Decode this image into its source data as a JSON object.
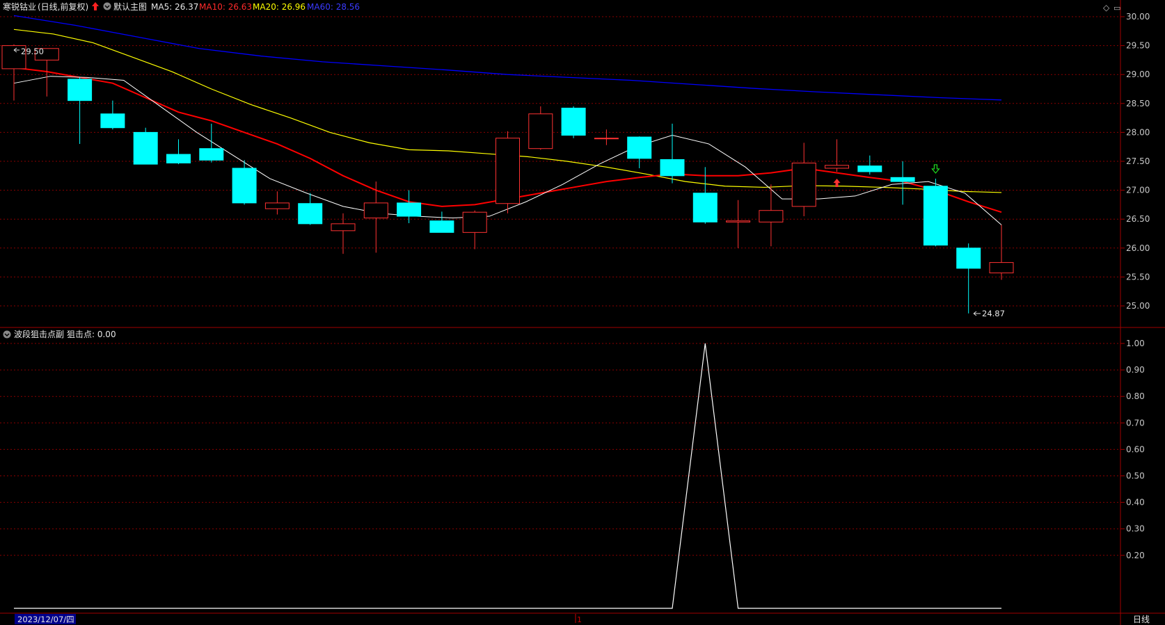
{
  "main_header": {
    "stock_name": "寒锐钴业",
    "period": "(日线,前复权)",
    "template": "默认主图",
    "ma5": "MA5: 26.37",
    "ma10": "MA10: 26.63",
    "ma20": "MA20: 26.96",
    "ma60": "MA60: 28.56"
  },
  "window_controls": {
    "diamond": "◇",
    "menu": "▭"
  },
  "price_axis": [
    "30.00",
    "29.50",
    "29.00",
    "28.50",
    "28.00",
    "27.50",
    "27.00",
    "26.50",
    "26.00",
    "25.50",
    "25.00"
  ],
  "high_label": "29.50",
  "low_label": "24.87",
  "sub_header": {
    "name": "波段狙击点副",
    "value": "狙击点: 0.00"
  },
  "sub_axis": [
    "1.00",
    "0.90",
    "0.80",
    "0.70",
    "0.60",
    "0.50",
    "0.40",
    "0.30",
    "0.20"
  ],
  "date_label": "2023/12/07/四",
  "date_marker": "1",
  "period_button": "日线",
  "colors": {
    "up": "#ff3232",
    "down": "#00ffff",
    "ma5": "#ffffff",
    "ma10": "#ff0000",
    "ma20": "#ffff00",
    "ma60": "#0000ff",
    "grid": "#8b0000",
    "axis_text": "#c8c8c8",
    "border": "#a00000"
  },
  "chart_data": {
    "type": "candlestick",
    "price_range": [
      24.6,
      30.1
    ],
    "sub_range": [
      0,
      1.0
    ],
    "candles": [
      {
        "o": 29.1,
        "h": 29.52,
        "l": 28.55,
        "c": 29.5
      },
      {
        "o": 29.25,
        "h": 29.45,
        "l": 28.62,
        "c": 29.45
      },
      {
        "o": 28.92,
        "h": 28.95,
        "l": 27.8,
        "c": 28.55
      },
      {
        "o": 28.32,
        "h": 28.55,
        "l": 28.05,
        "c": 28.08
      },
      {
        "o": 28.0,
        "h": 28.08,
        "l": 27.45,
        "c": 27.45
      },
      {
        "o": 27.62,
        "h": 27.88,
        "l": 27.45,
        "c": 27.47
      },
      {
        "o": 27.72,
        "h": 28.15,
        "l": 27.48,
        "c": 27.52
      },
      {
        "o": 27.38,
        "h": 27.52,
        "l": 26.75,
        "c": 26.78
      },
      {
        "o": 26.68,
        "h": 26.98,
        "l": 26.58,
        "c": 26.78
      },
      {
        "o": 26.77,
        "h": 26.95,
        "l": 26.4,
        "c": 26.42
      },
      {
        "o": 26.3,
        "h": 26.6,
        "l": 25.9,
        "c": 26.42
      },
      {
        "o": 26.52,
        "h": 27.15,
        "l": 25.92,
        "c": 26.78
      },
      {
        "o": 26.78,
        "h": 27.0,
        "l": 26.43,
        "c": 26.55
      },
      {
        "o": 26.47,
        "h": 26.63,
        "l": 26.27,
        "c": 26.27
      },
      {
        "o": 26.27,
        "h": 26.65,
        "l": 25.98,
        "c": 26.62
      },
      {
        "o": 26.77,
        "h": 28.02,
        "l": 26.6,
        "c": 27.9
      },
      {
        "o": 27.72,
        "h": 28.45,
        "l": 27.7,
        "c": 28.32
      },
      {
        "o": 28.42,
        "h": 28.45,
        "l": 27.9,
        "c": 27.95
      },
      {
        "o": 27.9,
        "h": 28.05,
        "l": 27.78,
        "c": 27.9
      },
      {
        "o": 27.92,
        "h": 27.93,
        "l": 27.38,
        "c": 27.55
      },
      {
        "o": 27.53,
        "h": 28.15,
        "l": 27.12,
        "c": 27.25
      },
      {
        "o": 26.95,
        "h": 27.4,
        "l": 26.42,
        "c": 26.45
      },
      {
        "o": 26.45,
        "h": 26.83,
        "l": 26.0,
        "c": 26.47
      },
      {
        "o": 26.45,
        "h": 27.1,
        "l": 26.03,
        "c": 26.65
      },
      {
        "o": 26.72,
        "h": 27.82,
        "l": 26.55,
        "c": 27.47
      },
      {
        "o": 27.38,
        "h": 27.88,
        "l": 27.32,
        "c": 27.43
      },
      {
        "o": 27.42,
        "h": 27.6,
        "l": 27.27,
        "c": 27.32
      },
      {
        "o": 27.22,
        "h": 27.5,
        "l": 26.75,
        "c": 27.15
      },
      {
        "o": 27.07,
        "h": 27.2,
        "l": 26.03,
        "c": 26.05
      },
      {
        "o": 26.0,
        "h": 26.08,
        "l": 24.87,
        "c": 25.65
      },
      {
        "o": 25.57,
        "h": 26.4,
        "l": 25.45,
        "c": 25.75
      }
    ],
    "ma5": [
      28.85,
      28.97,
      28.95,
      28.9,
      28.45,
      28.0,
      27.6,
      27.2,
      26.95,
      26.72,
      26.6,
      26.55,
      26.52,
      26.55,
      26.8,
      27.1,
      27.45,
      27.75,
      27.95,
      27.8,
      27.4,
      26.85,
      26.85,
      26.9,
      27.1,
      27.15,
      26.95,
      26.4
    ],
    "ma10": [
      29.12,
      29.05,
      28.95,
      28.85,
      28.6,
      28.35,
      28.2,
      28.0,
      27.8,
      27.55,
      27.25,
      27.0,
      26.8,
      26.72,
      26.75,
      26.85,
      26.95,
      27.05,
      27.15,
      27.22,
      27.28,
      27.25,
      27.25,
      27.3,
      27.38,
      27.3,
      27.22,
      27.15,
      27.0,
      26.8,
      26.62
    ],
    "ma20": [
      29.78,
      29.7,
      29.55,
      29.3,
      29.05,
      28.75,
      28.48,
      28.25,
      28.0,
      27.82,
      27.7,
      27.68,
      27.63,
      27.58,
      27.5,
      27.4,
      27.28,
      27.15,
      27.07,
      27.05,
      27.08,
      27.07,
      27.05,
      27.02,
      26.98,
      26.96
    ],
    "ma60": [
      30.02,
      29.85,
      29.65,
      29.45,
      29.32,
      29.22,
      29.15,
      29.08,
      29.0,
      28.95,
      28.9,
      28.83,
      28.76,
      28.7,
      28.65,
      28.6,
      28.56
    ],
    "sub_line": [
      0,
      0,
      0,
      0,
      0,
      0,
      0,
      0,
      0,
      0,
      0,
      0,
      0,
      0,
      0,
      0,
      0,
      0,
      0,
      0,
      0,
      1,
      0,
      0,
      0,
      0,
      0,
      0,
      0,
      0,
      0
    ],
    "up_signal_index": 25,
    "down_signal_index": 28
  }
}
